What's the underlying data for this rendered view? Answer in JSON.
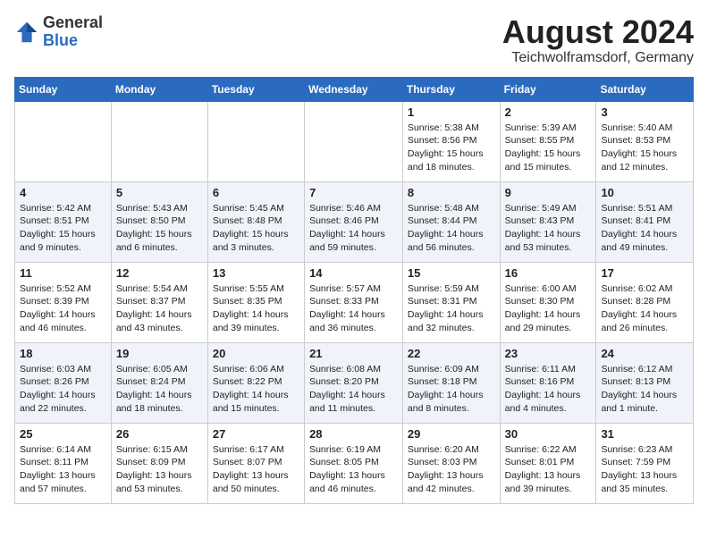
{
  "header": {
    "logo_general": "General",
    "logo_blue": "Blue",
    "month_year": "August 2024",
    "location": "Teichwolframsdorf, Germany"
  },
  "days_of_week": [
    "Sunday",
    "Monday",
    "Tuesday",
    "Wednesday",
    "Thursday",
    "Friday",
    "Saturday"
  ],
  "weeks": [
    [
      {
        "day": "",
        "text": ""
      },
      {
        "day": "",
        "text": ""
      },
      {
        "day": "",
        "text": ""
      },
      {
        "day": "",
        "text": ""
      },
      {
        "day": "1",
        "text": "Sunrise: 5:38 AM\nSunset: 8:56 PM\nDaylight: 15 hours\nand 18 minutes."
      },
      {
        "day": "2",
        "text": "Sunrise: 5:39 AM\nSunset: 8:55 PM\nDaylight: 15 hours\nand 15 minutes."
      },
      {
        "day": "3",
        "text": "Sunrise: 5:40 AM\nSunset: 8:53 PM\nDaylight: 15 hours\nand 12 minutes."
      }
    ],
    [
      {
        "day": "4",
        "text": "Sunrise: 5:42 AM\nSunset: 8:51 PM\nDaylight: 15 hours\nand 9 minutes."
      },
      {
        "day": "5",
        "text": "Sunrise: 5:43 AM\nSunset: 8:50 PM\nDaylight: 15 hours\nand 6 minutes."
      },
      {
        "day": "6",
        "text": "Sunrise: 5:45 AM\nSunset: 8:48 PM\nDaylight: 15 hours\nand 3 minutes."
      },
      {
        "day": "7",
        "text": "Sunrise: 5:46 AM\nSunset: 8:46 PM\nDaylight: 14 hours\nand 59 minutes."
      },
      {
        "day": "8",
        "text": "Sunrise: 5:48 AM\nSunset: 8:44 PM\nDaylight: 14 hours\nand 56 minutes."
      },
      {
        "day": "9",
        "text": "Sunrise: 5:49 AM\nSunset: 8:43 PM\nDaylight: 14 hours\nand 53 minutes."
      },
      {
        "day": "10",
        "text": "Sunrise: 5:51 AM\nSunset: 8:41 PM\nDaylight: 14 hours\nand 49 minutes."
      }
    ],
    [
      {
        "day": "11",
        "text": "Sunrise: 5:52 AM\nSunset: 8:39 PM\nDaylight: 14 hours\nand 46 minutes."
      },
      {
        "day": "12",
        "text": "Sunrise: 5:54 AM\nSunset: 8:37 PM\nDaylight: 14 hours\nand 43 minutes."
      },
      {
        "day": "13",
        "text": "Sunrise: 5:55 AM\nSunset: 8:35 PM\nDaylight: 14 hours\nand 39 minutes."
      },
      {
        "day": "14",
        "text": "Sunrise: 5:57 AM\nSunset: 8:33 PM\nDaylight: 14 hours\nand 36 minutes."
      },
      {
        "day": "15",
        "text": "Sunrise: 5:59 AM\nSunset: 8:31 PM\nDaylight: 14 hours\nand 32 minutes."
      },
      {
        "day": "16",
        "text": "Sunrise: 6:00 AM\nSunset: 8:30 PM\nDaylight: 14 hours\nand 29 minutes."
      },
      {
        "day": "17",
        "text": "Sunrise: 6:02 AM\nSunset: 8:28 PM\nDaylight: 14 hours\nand 26 minutes."
      }
    ],
    [
      {
        "day": "18",
        "text": "Sunrise: 6:03 AM\nSunset: 8:26 PM\nDaylight: 14 hours\nand 22 minutes."
      },
      {
        "day": "19",
        "text": "Sunrise: 6:05 AM\nSunset: 8:24 PM\nDaylight: 14 hours\nand 18 minutes."
      },
      {
        "day": "20",
        "text": "Sunrise: 6:06 AM\nSunset: 8:22 PM\nDaylight: 14 hours\nand 15 minutes."
      },
      {
        "day": "21",
        "text": "Sunrise: 6:08 AM\nSunset: 8:20 PM\nDaylight: 14 hours\nand 11 minutes."
      },
      {
        "day": "22",
        "text": "Sunrise: 6:09 AM\nSunset: 8:18 PM\nDaylight: 14 hours\nand 8 minutes."
      },
      {
        "day": "23",
        "text": "Sunrise: 6:11 AM\nSunset: 8:16 PM\nDaylight: 14 hours\nand 4 minutes."
      },
      {
        "day": "24",
        "text": "Sunrise: 6:12 AM\nSunset: 8:13 PM\nDaylight: 14 hours\nand 1 minute."
      }
    ],
    [
      {
        "day": "25",
        "text": "Sunrise: 6:14 AM\nSunset: 8:11 PM\nDaylight: 13 hours\nand 57 minutes."
      },
      {
        "day": "26",
        "text": "Sunrise: 6:15 AM\nSunset: 8:09 PM\nDaylight: 13 hours\nand 53 minutes."
      },
      {
        "day": "27",
        "text": "Sunrise: 6:17 AM\nSunset: 8:07 PM\nDaylight: 13 hours\nand 50 minutes."
      },
      {
        "day": "28",
        "text": "Sunrise: 6:19 AM\nSunset: 8:05 PM\nDaylight: 13 hours\nand 46 minutes."
      },
      {
        "day": "29",
        "text": "Sunrise: 6:20 AM\nSunset: 8:03 PM\nDaylight: 13 hours\nand 42 minutes."
      },
      {
        "day": "30",
        "text": "Sunrise: 6:22 AM\nSunset: 8:01 PM\nDaylight: 13 hours\nand 39 minutes."
      },
      {
        "day": "31",
        "text": "Sunrise: 6:23 AM\nSunset: 7:59 PM\nDaylight: 13 hours\nand 35 minutes."
      }
    ]
  ]
}
